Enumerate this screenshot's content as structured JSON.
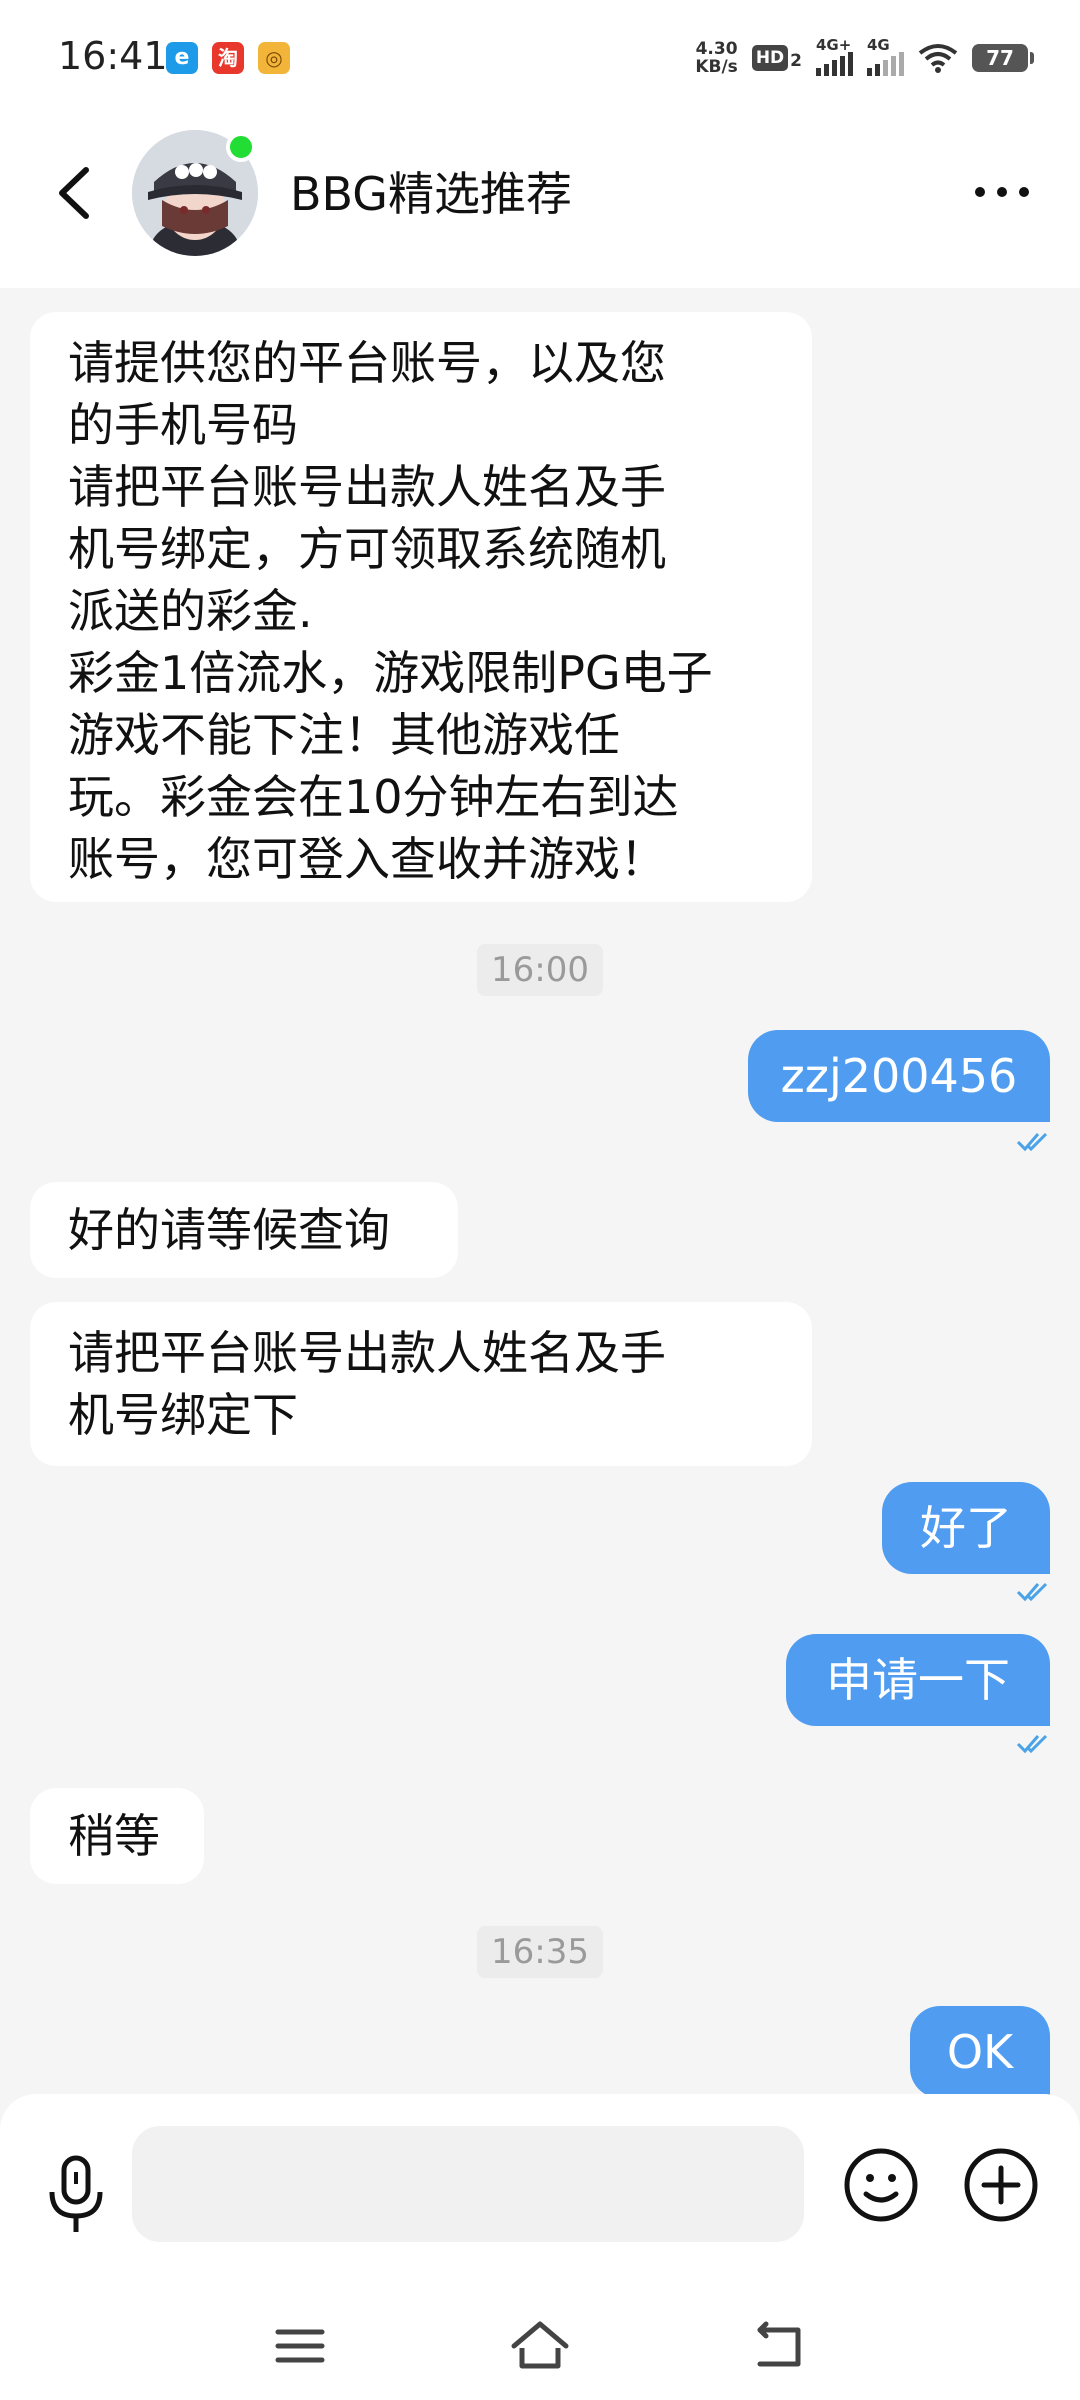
{
  "status_bar": {
    "time": "16:41",
    "app_icons": [
      "e-icon",
      "taobao-icon",
      "coin-icon"
    ],
    "taobao_label": "淘",
    "net_speed_value": "4.30",
    "net_speed_unit": "KB/s",
    "hd_label": "HD",
    "hd_sub": "2",
    "signal1_label": "4G+",
    "signal2_label": "4G",
    "battery": "77"
  },
  "header": {
    "title": "BBG精选推荐",
    "online": true
  },
  "messages": [
    {
      "dir": "in",
      "text": "请提供您的平台账号，以及您\n的手机号码\n请把平台账号出款人姓名及手\n机号绑定，方可领取系统随机\n派送的彩金.\n彩金1倍流水，游戏限制PG电子\n游戏不能下注！其他游戏任\n玩。彩金会在10分钟左右到达\n账号，您可登入查收并游戏！"
    },
    {
      "timestamp": "16:00"
    },
    {
      "dir": "out",
      "text": "zzj200456",
      "read": true
    },
    {
      "dir": "in",
      "text": "好的请等候查询"
    },
    {
      "dir": "in",
      "text": "请把平台账号出款人姓名及手\n机号绑定下"
    },
    {
      "dir": "out",
      "text": "好了",
      "read": true
    },
    {
      "dir": "out",
      "text": "申请一下",
      "read": true
    },
    {
      "dir": "in",
      "text": "稍等"
    },
    {
      "timestamp": "16:35"
    },
    {
      "dir": "out",
      "text": "OK"
    }
  ],
  "input": {
    "value": "",
    "placeholder": ""
  },
  "colors": {
    "outgoing_bubble": "#4f9cf0",
    "incoming_bubble": "#ffffff",
    "background": "#f5f5f5",
    "read_tick": "#4aa3e8",
    "online_dot": "#22dd33"
  }
}
